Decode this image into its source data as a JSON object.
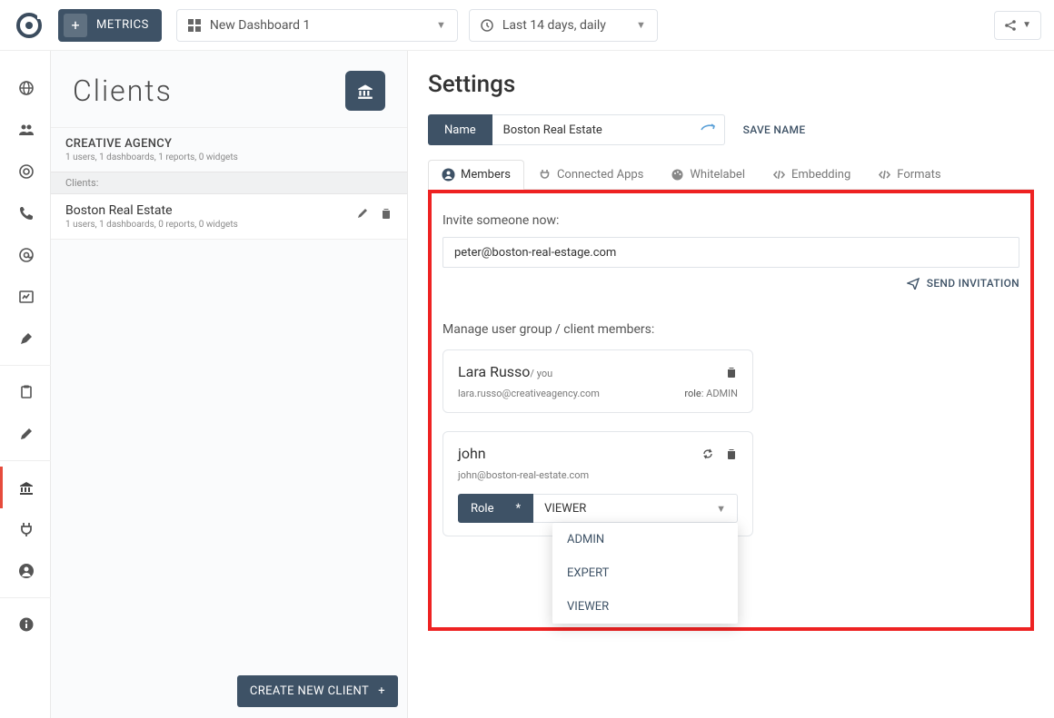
{
  "topbar": {
    "metrics_label": "METRICS",
    "dashboard_name": "New Dashboard 1",
    "date_range": "Last 14 days, daily"
  },
  "clients_panel": {
    "title": "Clients",
    "agency_name": "CREATIVE AGENCY",
    "agency_meta": "1 users, 1 dashboards, 1 reports, 0 widgets",
    "section_label": "Clients:",
    "client": {
      "name": "Boston Real Estate",
      "meta": "1 users, 1 dashboards, 0 reports, 0 widgets"
    },
    "create_label": "CREATE NEW CLIENT"
  },
  "settings": {
    "title": "Settings",
    "name_label": "Name",
    "name_value": "Boston Real Estate",
    "save_name": "SAVE NAME",
    "tabs": {
      "members": "Members",
      "connected_apps": "Connected Apps",
      "whitelabel": "Whitelabel",
      "embedding": "Embedding",
      "formats": "Formats"
    },
    "invite_label": "Invite someone now:",
    "invite_value": "peter@boston-real-estage.com",
    "send_label": "SEND INVITATION",
    "manage_label": "Manage user group / client members:",
    "member1": {
      "name": "Lara Russo",
      "you": "/ you",
      "email": "lara.russo@creativeagency.com",
      "role_label": "role",
      "role_value": ": ADMIN"
    },
    "member2": {
      "name": "john",
      "email": "john@boston-real-estate.com",
      "role_field_label": "Role",
      "role_star": "*",
      "role_selected": "VIEWER",
      "options": {
        "admin": "ADMIN",
        "expert": "EXPERT",
        "viewer": "VIEWER"
      }
    }
  }
}
